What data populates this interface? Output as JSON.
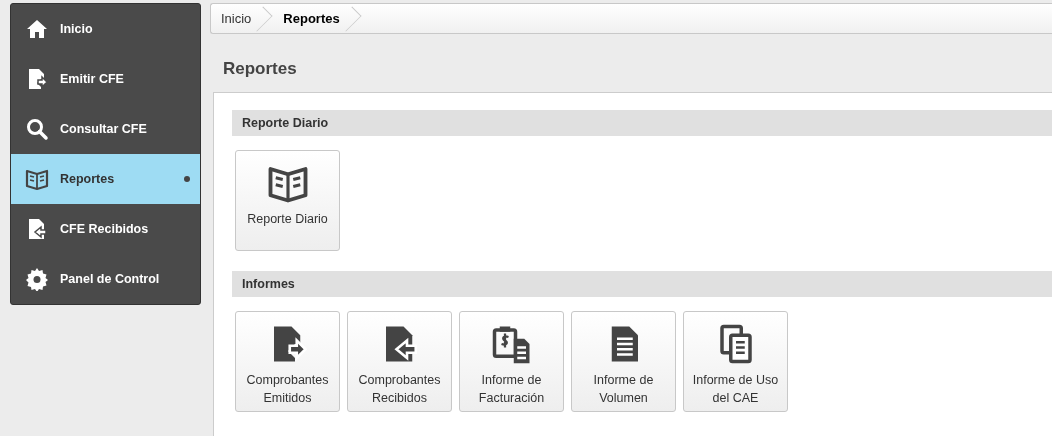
{
  "sidebar": {
    "items": [
      {
        "label": "Inicio",
        "kind": "home",
        "selected": false
      },
      {
        "label": "Emitir CFE",
        "kind": "doc-out",
        "selected": false
      },
      {
        "label": "Consultar CFE",
        "kind": "search",
        "selected": false
      },
      {
        "label": "Reportes",
        "kind": "book",
        "selected": true
      },
      {
        "label": "CFE Recibidos",
        "kind": "doc-in",
        "selected": false
      },
      {
        "label": "Panel de Control",
        "kind": "gear",
        "selected": false
      }
    ]
  },
  "breadcrumb": [
    {
      "label": "Inicio",
      "selected": false
    },
    {
      "label": "Reportes",
      "selected": true
    }
  ],
  "page_title": "Reportes",
  "sections": [
    {
      "title": "Reporte Diario",
      "tiles": [
        {
          "label": "Reporte Diario",
          "kind": "book"
        }
      ]
    },
    {
      "title": "Informes",
      "tiles": [
        {
          "label": "Comprobantes Emitidos",
          "kind": "doc-out"
        },
        {
          "label": "Comprobantes Recibidos",
          "kind": "doc-in"
        },
        {
          "label": "Informe de Facturación",
          "kind": "invoice"
        },
        {
          "label": "Informe de Volumen",
          "kind": "document"
        },
        {
          "label": "Informe de Uso del CAE",
          "kind": "copies"
        }
      ]
    }
  ]
}
